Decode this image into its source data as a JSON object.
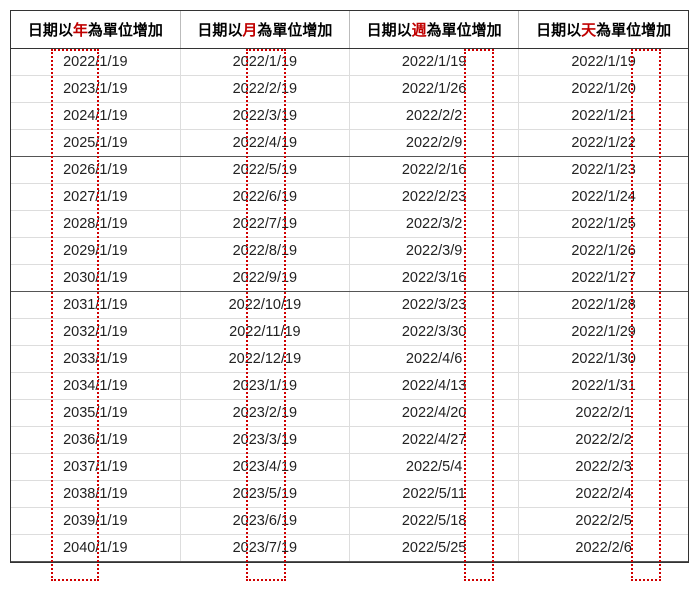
{
  "headers": {
    "pre": "日期以",
    "post": "為單位增加",
    "units": [
      "年",
      "月",
      "週",
      "天"
    ]
  },
  "columns": {
    "year": [
      "2022/1/19",
      "2023/1/19",
      "2024/1/19",
      "2025/1/19",
      "2026/1/19",
      "2027/1/19",
      "2028/1/19",
      "2029/1/19",
      "2030/1/19",
      "2031/1/19",
      "2032/1/19",
      "2033/1/19",
      "2034/1/19",
      "2035/1/19",
      "2036/1/19",
      "2037/1/19",
      "2038/1/19",
      "2039/1/19",
      "2040/1/19"
    ],
    "month": [
      "2022/1/19",
      "2022/2/19",
      "2022/3/19",
      "2022/4/19",
      "2022/5/19",
      "2022/6/19",
      "2022/7/19",
      "2022/8/19",
      "2022/9/19",
      "2022/10/19",
      "2022/11/19",
      "2022/12/19",
      "2023/1/19",
      "2023/2/19",
      "2023/3/19",
      "2023/4/19",
      "2023/5/19",
      "2023/6/19",
      "2023/7/19"
    ],
    "week": [
      "2022/1/19",
      "2022/1/26",
      "2022/2/2",
      "2022/2/9",
      "2022/2/16",
      "2022/2/23",
      "2022/3/2",
      "2022/3/9",
      "2022/3/16",
      "2022/3/23",
      "2022/3/30",
      "2022/4/6",
      "2022/4/13",
      "2022/4/20",
      "2022/4/27",
      "2022/5/4",
      "2022/5/11",
      "2022/5/18",
      "2022/5/25"
    ],
    "day": [
      "2022/1/19",
      "2022/1/20",
      "2022/1/21",
      "2022/1/22",
      "2022/1/23",
      "2022/1/24",
      "2022/1/25",
      "2022/1/26",
      "2022/1/27",
      "2022/1/28",
      "2022/1/29",
      "2022/1/30",
      "2022/1/31",
      "2022/2/1",
      "2022/2/2",
      "2022/2/3",
      "2022/2/4",
      "2022/2/5",
      "2022/2/6"
    ]
  },
  "chart_data": {
    "type": "table",
    "title": "Date series incremented by year/month/week/day",
    "columns": [
      "日期以年為單位增加",
      "日期以月為單位增加",
      "日期以週為單位增加",
      "日期以天為單位增加"
    ],
    "rows": [
      [
        "2022/1/19",
        "2022/1/19",
        "2022/1/19",
        "2022/1/19"
      ],
      [
        "2023/1/19",
        "2022/2/19",
        "2022/1/26",
        "2022/1/20"
      ],
      [
        "2024/1/19",
        "2022/3/19",
        "2022/2/2",
        "2022/1/21"
      ],
      [
        "2025/1/19",
        "2022/4/19",
        "2022/2/9",
        "2022/1/22"
      ],
      [
        "2026/1/19",
        "2022/5/19",
        "2022/2/16",
        "2022/1/23"
      ],
      [
        "2027/1/19",
        "2022/6/19",
        "2022/2/23",
        "2022/1/24"
      ],
      [
        "2028/1/19",
        "2022/7/19",
        "2022/3/2",
        "2022/1/25"
      ],
      [
        "2029/1/19",
        "2022/8/19",
        "2022/3/9",
        "2022/1/26"
      ],
      [
        "2030/1/19",
        "2022/9/19",
        "2022/3/16",
        "2022/1/27"
      ],
      [
        "2031/1/19",
        "2022/10/19",
        "2022/3/23",
        "2022/1/28"
      ],
      [
        "2032/1/19",
        "2022/11/19",
        "2022/3/30",
        "2022/1/29"
      ],
      [
        "2033/1/19",
        "2022/12/19",
        "2022/4/6",
        "2022/1/30"
      ],
      [
        "2034/1/19",
        "2023/1/19",
        "2022/4/13",
        "2022/1/31"
      ],
      [
        "2035/1/19",
        "2023/2/19",
        "2022/4/20",
        "2022/2/1"
      ],
      [
        "2036/1/19",
        "2023/3/19",
        "2022/4/27",
        "2022/2/2"
      ],
      [
        "2037/1/19",
        "2023/4/19",
        "2022/5/4",
        "2022/2/3"
      ],
      [
        "2038/1/19",
        "2023/5/19",
        "2022/5/11",
        "2022/2/4"
      ],
      [
        "2039/1/19",
        "2023/6/19",
        "2022/5/18",
        "2022/2/5"
      ],
      [
        "2040/1/19",
        "2023/7/19",
        "2022/5/25",
        "2022/2/6"
      ]
    ]
  }
}
